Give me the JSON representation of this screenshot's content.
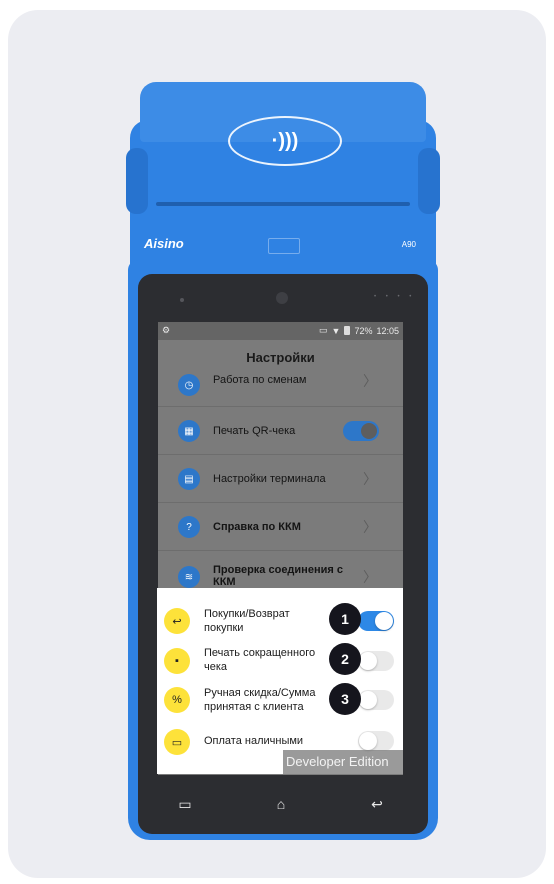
{
  "device": {
    "brand": "Aisino",
    "model": "A90",
    "nfc_symbol": "·)))"
  },
  "statusbar": {
    "left_icon": "settings-icon",
    "battery": "72%",
    "time": "12:05"
  },
  "settings": {
    "title": "Настройки",
    "items": [
      {
        "label": "Работа по сменам",
        "icon": "shift-icon",
        "control": "chevron"
      },
      {
        "label": "Печать QR-чека",
        "icon": "qr-icon",
        "control": "toggle-on"
      },
      {
        "label": "Настройки терминала",
        "icon": "terminal-icon",
        "control": "chevron"
      },
      {
        "label": "Справка по ККМ",
        "icon": "help-icon",
        "icon_glyph": "?",
        "control": "chevron"
      },
      {
        "label": "Проверка соединения с ККМ",
        "icon": "wifi-icon",
        "control": "chevron"
      }
    ]
  },
  "options": [
    {
      "label": "Покупки/Возврат покупки",
      "icon": "return-icon",
      "glyph": "↩",
      "enabled": true,
      "badge": "1"
    },
    {
      "label": "Печать сокращенного чека",
      "icon": "receipt-icon",
      "glyph": "▪",
      "enabled": false,
      "badge": "2"
    },
    {
      "label": "Ручная скидка/Сумма принятая с клиента",
      "icon": "discount-icon",
      "glyph": "%",
      "enabled": false,
      "badge": "3"
    },
    {
      "label": "Оплата наличными",
      "icon": "cash-icon",
      "glyph": "▭",
      "enabled": false
    }
  ],
  "watermark": "Developer Edition",
  "navbar": [
    "menu-icon",
    "home-icon",
    "back-icon"
  ],
  "colors": {
    "device_blue": "#2f82e3",
    "toggle_on": "#2d88e6",
    "icon_yellow": "#fde23a",
    "badge_dark": "#15151d"
  }
}
